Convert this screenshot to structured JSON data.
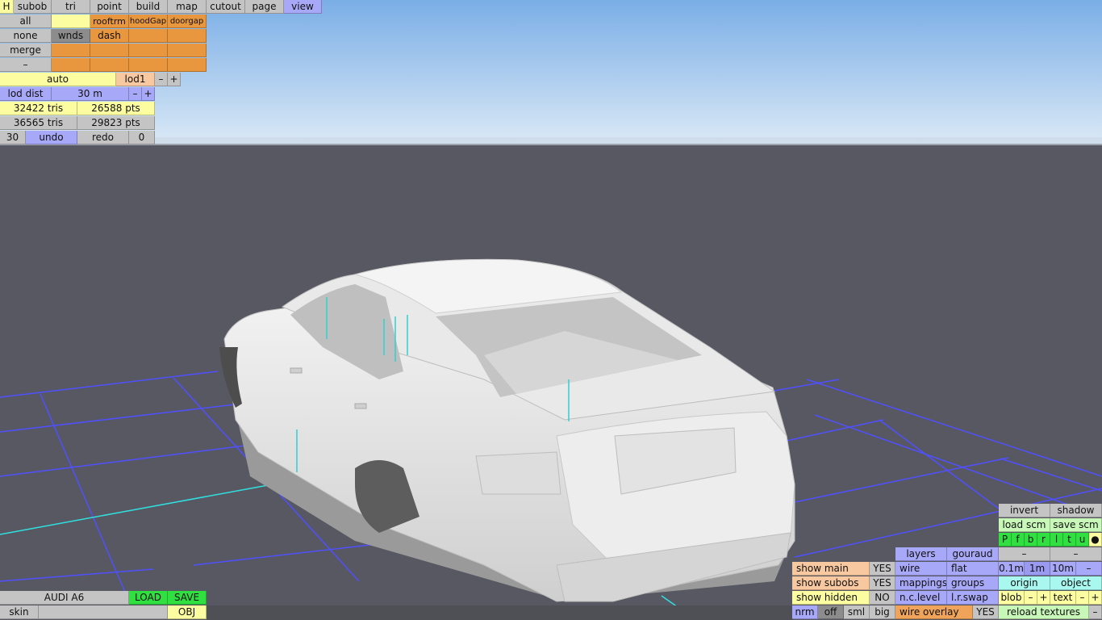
{
  "colors": {
    "sky_top": "#7aaee6",
    "sky_bottom": "#d5e6f5",
    "ground": "#575862",
    "grid": "#5050ff",
    "axis": "#30e0e0",
    "car_body": "#e6e6e6"
  },
  "top_menu": {
    "h": "H",
    "tabs": [
      "subob",
      "tri",
      "point",
      "build",
      "map",
      "cutout",
      "page",
      "view"
    ],
    "active_tab": "view"
  },
  "subob_panel": {
    "rows": [
      [
        "all",
        "",
        "rooftrm",
        "hoodGap",
        "doorgap"
      ],
      [
        "none",
        "wnds",
        "dash",
        "",
        ""
      ],
      [
        "merge",
        "",
        "",
        "",
        ""
      ],
      [
        "–",
        "",
        "",
        "",
        ""
      ]
    ]
  },
  "lod": {
    "auto": "auto",
    "lod_label": "lod1",
    "minus": "–",
    "plus": "+",
    "dist_label": "lod dist",
    "dist_value": "30 m"
  },
  "stats": {
    "tris1": "32422 tris",
    "pts1": "26588 pts",
    "tris2": "36565 tris",
    "pts2": "29823 pts"
  },
  "history": {
    "count": "30",
    "undo": "undo",
    "redo": "redo",
    "redo_count": "0"
  },
  "file_panel": {
    "name": "AUDI A6",
    "load": "LOAD",
    "save": "SAVE",
    "skin": "skin",
    "obj": "OBJ"
  },
  "view_panel": {
    "invert": "invert",
    "shadow": "shadow",
    "load_scm": "load scm",
    "save_scm": "save scm",
    "letters": [
      "P",
      "f",
      "b",
      "r",
      "l",
      "t",
      "u",
      "●"
    ],
    "minus": "–",
    "plus": "+",
    "layers": "layers",
    "gouraud": "gouraud",
    "show_main": "show main",
    "show_main_val": "YES",
    "wire": "wire",
    "flat": "flat",
    "scale_01": "0.1m",
    "scale_1": "1m",
    "scale_10": "10m",
    "show_subobs": "show subobs",
    "show_subobs_val": "YES",
    "mappings": "mappings",
    "groups": "groups",
    "origin": "origin",
    "object": "object",
    "show_hidden": "show hidden",
    "show_hidden_val": "NO",
    "nc_level": "n.c.level",
    "lr_swap": "l.r.swap",
    "blob": "blob",
    "text": "text",
    "nrm": "nrm",
    "off": "off",
    "sml": "sml",
    "big": "big",
    "wire_overlay": "wire overlay",
    "wire_overlay_val": "YES",
    "reload_textures": "reload textures"
  }
}
